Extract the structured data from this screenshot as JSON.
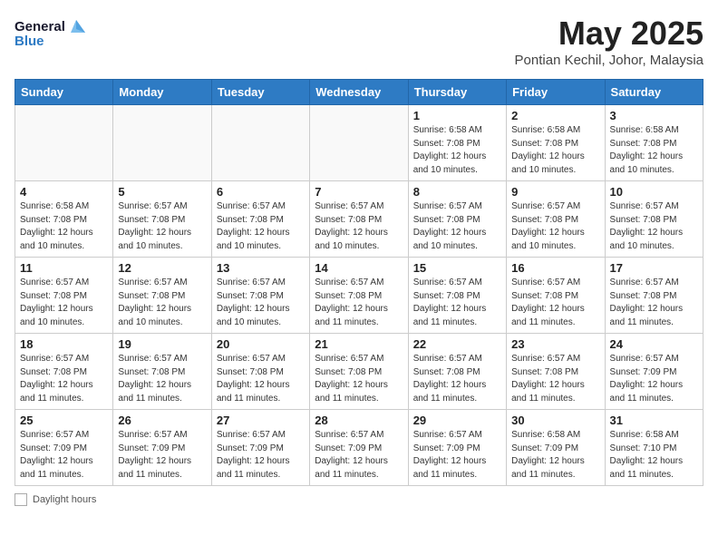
{
  "header": {
    "logo_line1": "General",
    "logo_line2": "Blue",
    "month_title": "May 2025",
    "location": "Pontian Kechil, Johor, Malaysia"
  },
  "weekdays": [
    "Sunday",
    "Monday",
    "Tuesday",
    "Wednesday",
    "Thursday",
    "Friday",
    "Saturday"
  ],
  "weeks": [
    [
      {
        "day": "",
        "info": ""
      },
      {
        "day": "",
        "info": ""
      },
      {
        "day": "",
        "info": ""
      },
      {
        "day": "",
        "info": ""
      },
      {
        "day": "1",
        "info": "Sunrise: 6:58 AM\nSunset: 7:08 PM\nDaylight: 12 hours\nand 10 minutes."
      },
      {
        "day": "2",
        "info": "Sunrise: 6:58 AM\nSunset: 7:08 PM\nDaylight: 12 hours\nand 10 minutes."
      },
      {
        "day": "3",
        "info": "Sunrise: 6:58 AM\nSunset: 7:08 PM\nDaylight: 12 hours\nand 10 minutes."
      }
    ],
    [
      {
        "day": "4",
        "info": "Sunrise: 6:58 AM\nSunset: 7:08 PM\nDaylight: 12 hours\nand 10 minutes."
      },
      {
        "day": "5",
        "info": "Sunrise: 6:57 AM\nSunset: 7:08 PM\nDaylight: 12 hours\nand 10 minutes."
      },
      {
        "day": "6",
        "info": "Sunrise: 6:57 AM\nSunset: 7:08 PM\nDaylight: 12 hours\nand 10 minutes."
      },
      {
        "day": "7",
        "info": "Sunrise: 6:57 AM\nSunset: 7:08 PM\nDaylight: 12 hours\nand 10 minutes."
      },
      {
        "day": "8",
        "info": "Sunrise: 6:57 AM\nSunset: 7:08 PM\nDaylight: 12 hours\nand 10 minutes."
      },
      {
        "day": "9",
        "info": "Sunrise: 6:57 AM\nSunset: 7:08 PM\nDaylight: 12 hours\nand 10 minutes."
      },
      {
        "day": "10",
        "info": "Sunrise: 6:57 AM\nSunset: 7:08 PM\nDaylight: 12 hours\nand 10 minutes."
      }
    ],
    [
      {
        "day": "11",
        "info": "Sunrise: 6:57 AM\nSunset: 7:08 PM\nDaylight: 12 hours\nand 10 minutes."
      },
      {
        "day": "12",
        "info": "Sunrise: 6:57 AM\nSunset: 7:08 PM\nDaylight: 12 hours\nand 10 minutes."
      },
      {
        "day": "13",
        "info": "Sunrise: 6:57 AM\nSunset: 7:08 PM\nDaylight: 12 hours\nand 10 minutes."
      },
      {
        "day": "14",
        "info": "Sunrise: 6:57 AM\nSunset: 7:08 PM\nDaylight: 12 hours\nand 11 minutes."
      },
      {
        "day": "15",
        "info": "Sunrise: 6:57 AM\nSunset: 7:08 PM\nDaylight: 12 hours\nand 11 minutes."
      },
      {
        "day": "16",
        "info": "Sunrise: 6:57 AM\nSunset: 7:08 PM\nDaylight: 12 hours\nand 11 minutes."
      },
      {
        "day": "17",
        "info": "Sunrise: 6:57 AM\nSunset: 7:08 PM\nDaylight: 12 hours\nand 11 minutes."
      }
    ],
    [
      {
        "day": "18",
        "info": "Sunrise: 6:57 AM\nSunset: 7:08 PM\nDaylight: 12 hours\nand 11 minutes."
      },
      {
        "day": "19",
        "info": "Sunrise: 6:57 AM\nSunset: 7:08 PM\nDaylight: 12 hours\nand 11 minutes."
      },
      {
        "day": "20",
        "info": "Sunrise: 6:57 AM\nSunset: 7:08 PM\nDaylight: 12 hours\nand 11 minutes."
      },
      {
        "day": "21",
        "info": "Sunrise: 6:57 AM\nSunset: 7:08 PM\nDaylight: 12 hours\nand 11 minutes."
      },
      {
        "day": "22",
        "info": "Sunrise: 6:57 AM\nSunset: 7:08 PM\nDaylight: 12 hours\nand 11 minutes."
      },
      {
        "day": "23",
        "info": "Sunrise: 6:57 AM\nSunset: 7:08 PM\nDaylight: 12 hours\nand 11 minutes."
      },
      {
        "day": "24",
        "info": "Sunrise: 6:57 AM\nSunset: 7:09 PM\nDaylight: 12 hours\nand 11 minutes."
      }
    ],
    [
      {
        "day": "25",
        "info": "Sunrise: 6:57 AM\nSunset: 7:09 PM\nDaylight: 12 hours\nand 11 minutes."
      },
      {
        "day": "26",
        "info": "Sunrise: 6:57 AM\nSunset: 7:09 PM\nDaylight: 12 hours\nand 11 minutes."
      },
      {
        "day": "27",
        "info": "Sunrise: 6:57 AM\nSunset: 7:09 PM\nDaylight: 12 hours\nand 11 minutes."
      },
      {
        "day": "28",
        "info": "Sunrise: 6:57 AM\nSunset: 7:09 PM\nDaylight: 12 hours\nand 11 minutes."
      },
      {
        "day": "29",
        "info": "Sunrise: 6:57 AM\nSunset: 7:09 PM\nDaylight: 12 hours\nand 11 minutes."
      },
      {
        "day": "30",
        "info": "Sunrise: 6:58 AM\nSunset: 7:09 PM\nDaylight: 12 hours\nand 11 minutes."
      },
      {
        "day": "31",
        "info": "Sunrise: 6:58 AM\nSunset: 7:10 PM\nDaylight: 12 hours\nand 11 minutes."
      }
    ]
  ],
  "footer": {
    "daylight_label": "Daylight hours"
  }
}
